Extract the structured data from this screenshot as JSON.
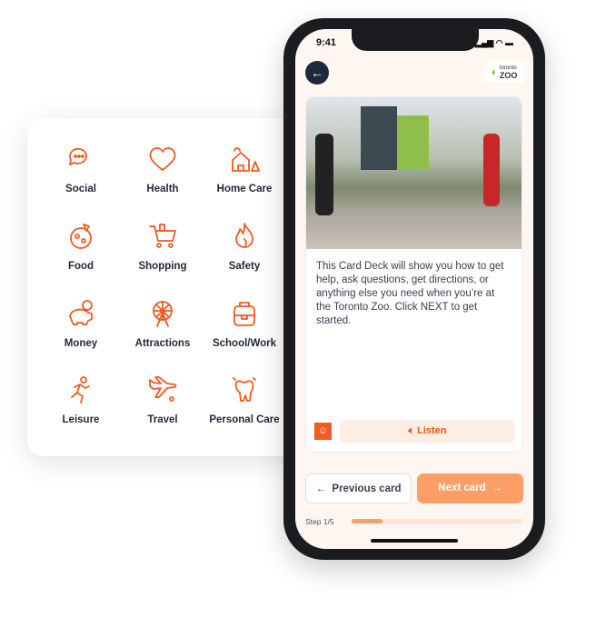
{
  "categories": [
    {
      "label": "Social",
      "icon": "speech-bubbles-icon"
    },
    {
      "label": "Health",
      "icon": "heart-icon"
    },
    {
      "label": "Home Care",
      "icon": "house-icon"
    },
    {
      "label": "Food",
      "icon": "pizza-icon"
    },
    {
      "label": "Shopping",
      "icon": "shopping-cart-icon"
    },
    {
      "label": "Safety",
      "icon": "flame-icon"
    },
    {
      "label": "Money",
      "icon": "piggy-bank-icon"
    },
    {
      "label": "Attractions",
      "icon": "ferris-wheel-icon"
    },
    {
      "label": "School/Work",
      "icon": "backpack-icon"
    },
    {
      "label": "Leisure",
      "icon": "running-person-icon"
    },
    {
      "label": "Travel",
      "icon": "airplane-icon"
    },
    {
      "label": "Personal Care",
      "icon": "tooth-icon"
    }
  ],
  "phone": {
    "time": "9:41",
    "logo_top": "toronto",
    "logo_bottom": "ZOO",
    "description": "This Card Deck will show you how to get help, ask questions, get directions, or anything else you need when you’re at the Toronto Zoo. Click NEXT to get started.",
    "listen_label": "Listen",
    "previous_label": "Previous card",
    "next_label": "Next card",
    "step_label": "Step 1/5",
    "progress": 0.18
  },
  "colors": {
    "accent": "#f15a22",
    "next_button": "#fd9d68"
  }
}
